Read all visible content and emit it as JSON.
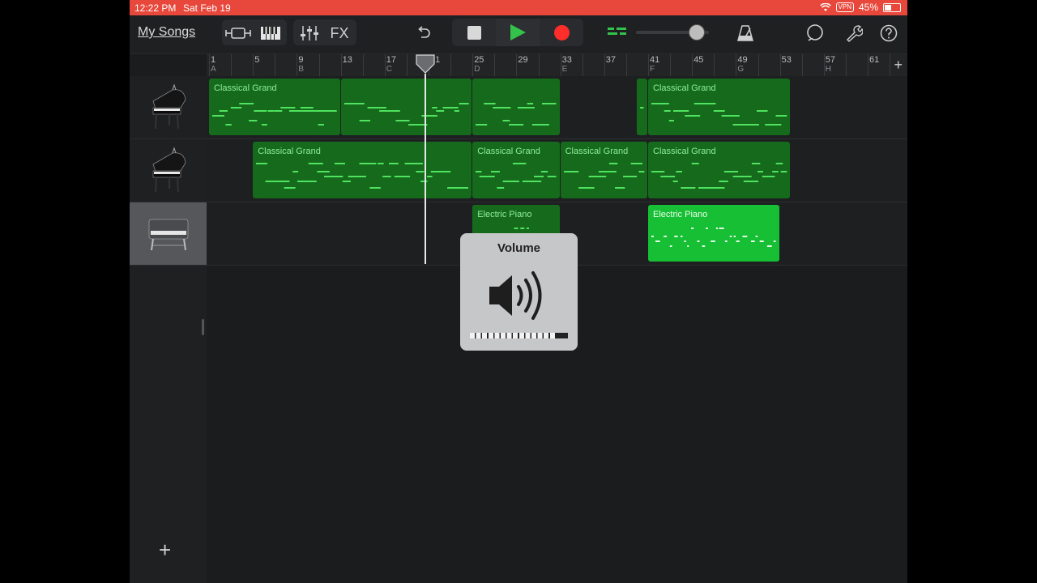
{
  "status_bar": {
    "time": "12:22 PM",
    "date": "Sat Feb 19",
    "vpn": "VPN",
    "battery": "45%",
    "battery_level": 0.45
  },
  "toolbar": {
    "my_songs": "My Songs",
    "fx_label": "FX",
    "icons": [
      "browser-icon",
      "keyboard-icon",
      "mixer-icon",
      "fx",
      "undo-icon",
      "stop-icon",
      "play-icon",
      "record-icon",
      "metronome-icon",
      "loop-icon",
      "wrench-icon",
      "help-icon"
    ],
    "play_color": "#33c24a",
    "record_color": "#ff2e2a"
  },
  "ruler": {
    "bars": [
      "1",
      "5",
      "9",
      "13",
      "17",
      "21",
      "25",
      "29",
      "33",
      "37",
      "41",
      "45",
      "49",
      "53",
      "57",
      "61"
    ],
    "sections": [
      {
        "bar": "1",
        "label": "A"
      },
      {
        "bar": "9",
        "label": "B"
      },
      {
        "bar": "17",
        "label": "C"
      },
      {
        "bar": "25",
        "label": "D"
      },
      {
        "bar": "33",
        "label": "E"
      },
      {
        "bar": "41",
        "label": "F"
      },
      {
        "bar": "49",
        "label": "G"
      },
      {
        "bar": "57",
        "label": "H"
      }
    ],
    "playhead_bar": 21
  },
  "tracks": [
    {
      "instrument": "grand-piano-icon",
      "selected": false,
      "regions": [
        {
          "label": "Classical Grand",
          "start": 1,
          "end": 13
        },
        {
          "label": "",
          "start": 13,
          "end": 25
        },
        {
          "label": "",
          "start": 25,
          "end": 33
        },
        {
          "label": "",
          "start": 40,
          "end": 41
        },
        {
          "label": "Classical Grand",
          "start": 41,
          "end": 54
        }
      ]
    },
    {
      "instrument": "grand-piano-icon",
      "selected": false,
      "regions": [
        {
          "label": "Classical Grand",
          "start": 5,
          "end": 25
        },
        {
          "label": "Classical Grand",
          "start": 25,
          "end": 33
        },
        {
          "label": "Classical Grand",
          "start": 33,
          "end": 41
        },
        {
          "label": "Classical Grand",
          "start": 41,
          "end": 54
        }
      ]
    },
    {
      "instrument": "electric-piano-icon",
      "selected": true,
      "regions": [
        {
          "label": "Electric Piano",
          "start": 25,
          "end": 33
        },
        {
          "label": "Electric Piano",
          "start": 41,
          "end": 53,
          "bright": true
        }
      ]
    }
  ],
  "volume_hud": {
    "title": "Volume",
    "level": 0.88
  }
}
